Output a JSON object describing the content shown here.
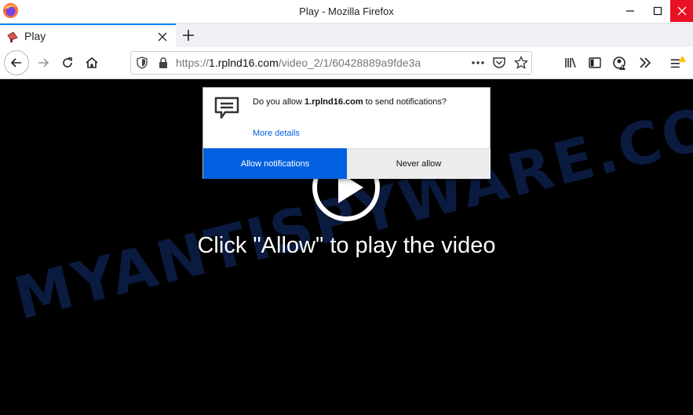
{
  "window": {
    "title": "Play - Mozilla Firefox"
  },
  "tab": {
    "label": "Play"
  },
  "urlbar": {
    "scheme": "https://",
    "domain": "1.rplnd16.com",
    "path": "/video_2/1/60428889a9fde3a"
  },
  "popup": {
    "message_prefix": "Do you allow ",
    "message_domain": "1.rplnd16.com",
    "message_suffix": " to send notifications?",
    "more_details": "More details",
    "allow_label": "Allow notifications",
    "deny_label": "Never allow"
  },
  "page": {
    "cta": "Click \"Allow\" to play the video",
    "watermark": "MYANTISPYWARE.COM"
  },
  "colors": {
    "accent": "#0060df",
    "tab_highlight": "#0a84ff",
    "close_red": "#e81123",
    "warning": "#ffbf00"
  },
  "icons": {
    "window_logo": "firefox-logo-icon",
    "tab_favicon": "megaphone-icon",
    "popup": "chat-bubble-icon"
  }
}
